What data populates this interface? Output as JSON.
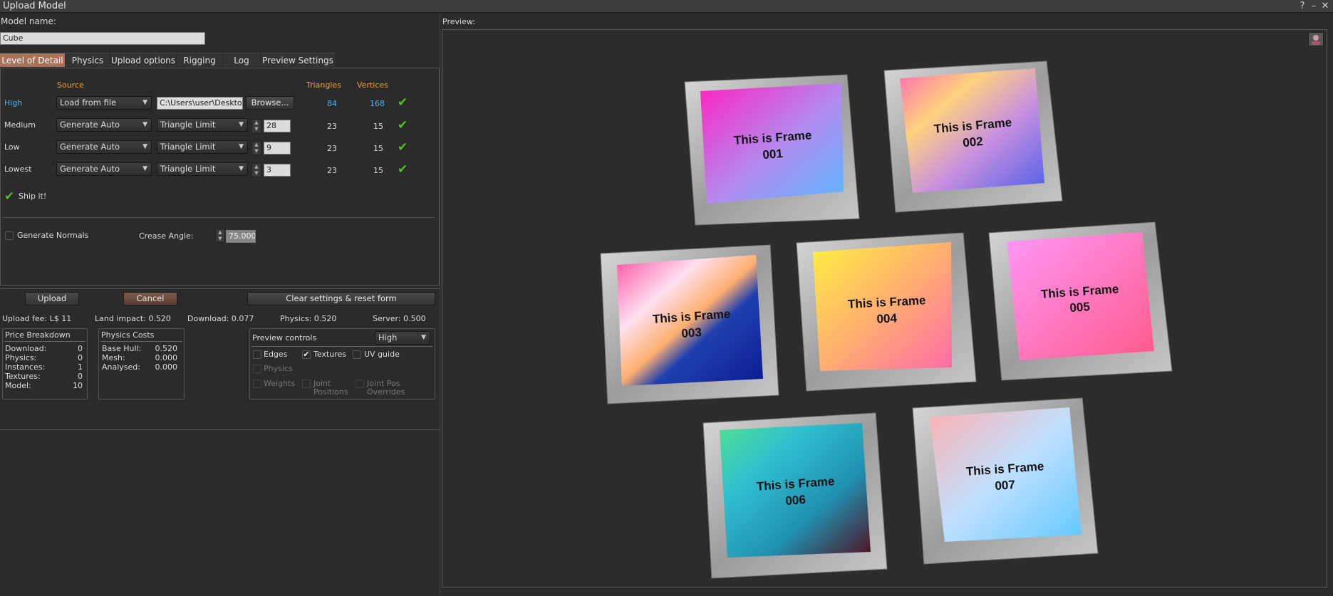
{
  "window": {
    "title": "Upload Model",
    "help": "?",
    "minimize": "–",
    "close": "✕"
  },
  "model_name": {
    "label": "Model name:",
    "value": "Cube"
  },
  "tabs": [
    "Level of Detail",
    "Physics",
    "Upload options",
    "Rigging",
    "Log",
    "Preview Settings"
  ],
  "lod": {
    "headers": {
      "source": "Source",
      "triangles": "Triangles",
      "vertices": "Vertices"
    },
    "high": {
      "label": "High",
      "source": "Load from file",
      "path": "C:\\Users\\user\\Desktop",
      "browse": "Browse...",
      "triangles": "84",
      "vertices": "168"
    },
    "rows": [
      {
        "label": "Medium",
        "source": "Generate Auto",
        "mode": "Triangle Limit",
        "limit": "28",
        "triangles": "23",
        "vertices": "15"
      },
      {
        "label": "Low",
        "source": "Generate Auto",
        "mode": "Triangle Limit",
        "limit": "9",
        "triangles": "23",
        "vertices": "15"
      },
      {
        "label": "Lowest",
        "source": "Generate Auto",
        "mode": "Triangle Limit",
        "limit": "3",
        "triangles": "23",
        "vertices": "15"
      }
    ],
    "ship_it": "Ship it!",
    "generate_normals": "Generate Normals",
    "crease_label": "Crease Angle:",
    "crease_value": "75.000"
  },
  "actions": {
    "upload": "Upload",
    "cancel": "Cancel",
    "clear": "Clear settings & reset form"
  },
  "fees": {
    "upload_fee": "Upload fee: L$ 11",
    "land_impact": "Land impact: 0.520",
    "download": "Download: 0.077",
    "physics": "Physics: 0.520",
    "server": "Server: 0.500"
  },
  "price_breakdown": {
    "title": "Price Breakdown",
    "rows": [
      {
        "label": "Download:",
        "value": "0"
      },
      {
        "label": "Physics:",
        "value": "0"
      },
      {
        "label": "Instances:",
        "value": "1"
      },
      {
        "label": "Textures:",
        "value": "0"
      },
      {
        "label": "Model:",
        "value": "10"
      }
    ]
  },
  "physics_costs": {
    "title": "Physics Costs",
    "rows": [
      {
        "label": "Base Hull:",
        "value": "0.520"
      },
      {
        "label": "Mesh:",
        "value": "0.000"
      },
      {
        "label": "Analysed:",
        "value": "0.000"
      }
    ]
  },
  "preview_controls": {
    "title": "Preview controls",
    "level": "High",
    "edges": "Edges",
    "textures": "Textures",
    "uv_guide": "UV guide",
    "physics": "Physics",
    "weights": "Weights",
    "joint_positions_1": "Joint",
    "joint_positions_2": "Positions",
    "joint_pos_overrides_1": "Joint Pos",
    "joint_pos_overrides_2": "Overrides"
  },
  "preview": {
    "label": "Preview:",
    "frames": [
      {
        "line1": "This is Frame",
        "line2": "001"
      },
      {
        "line1": "This is Frame",
        "line2": "002"
      },
      {
        "line1": "This is Frame",
        "line2": "003"
      },
      {
        "line1": "This is Frame",
        "line2": "004"
      },
      {
        "line1": "This is Frame",
        "line2": "005"
      },
      {
        "line1": "This is Frame",
        "line2": "006"
      },
      {
        "line1": "This is Frame",
        "line2": "007"
      }
    ]
  },
  "colors": {
    "accent": "#a9705a",
    "orange": "#f0a030",
    "blue": "#4cb4e8",
    "check": "#4ec21c"
  }
}
